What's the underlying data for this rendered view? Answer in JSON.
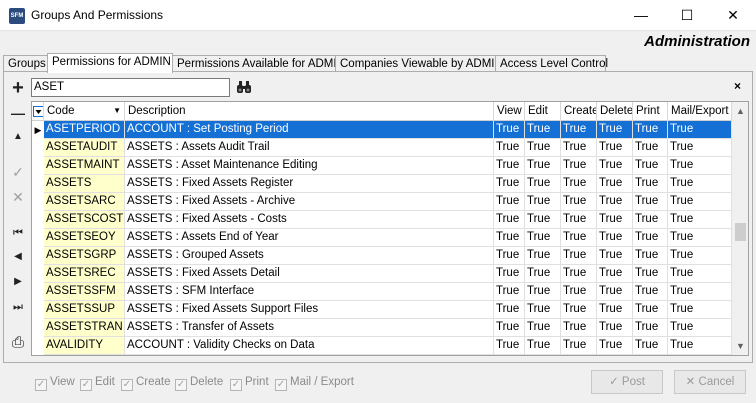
{
  "window": {
    "title": "Groups And Permissions",
    "app_icon_text": "SFM",
    "minimize_glyph": "—",
    "maximize_glyph": "☐",
    "close_glyph": "✕"
  },
  "header": {
    "section_label": "Administration"
  },
  "tabs": [
    {
      "label": "Groups",
      "active": false
    },
    {
      "label": "Permissions for ADMIN",
      "active": true
    },
    {
      "label": "Permissions Available for ADMIN",
      "active": false
    },
    {
      "label": "Companies Viewable by ADMIN",
      "active": false
    },
    {
      "label": "Access Level Control",
      "active": false
    }
  ],
  "filter": {
    "value": "ASET",
    "close_glyph": "×"
  },
  "sidebar": {
    "add_glyph": "+",
    "remove_glyph": "—",
    "up_glyph": "▲",
    "confirm_glyph": "✓",
    "cancel_glyph": "✕",
    "first_glyph": "⏮",
    "prev_glyph": "◀",
    "next_glyph": "▶",
    "last_glyph": "⏭",
    "print_glyph": "⎙"
  },
  "grid": {
    "columns": [
      "Code",
      "Description",
      "View",
      "Edit",
      "Create",
      "Delete",
      "Print",
      "Mail/Export"
    ],
    "rows": [
      [
        "ASETPERIOD",
        "ACCOUNT : Set Posting Period",
        "True",
        "True",
        "True",
        "True",
        "True",
        "True"
      ],
      [
        "ASSETAUDIT",
        "ASSETS : Assets Audit Trail",
        "True",
        "True",
        "True",
        "True",
        "True",
        "True"
      ],
      [
        "ASSETMAINT",
        "ASSETS : Asset Maintenance Editing",
        "True",
        "True",
        "True",
        "True",
        "True",
        "True"
      ],
      [
        "ASSETS",
        "ASSETS : Fixed Assets Register",
        "True",
        "True",
        "True",
        "True",
        "True",
        "True"
      ],
      [
        "ASSETSARC",
        "ASSETS : Fixed Assets - Archive",
        "True",
        "True",
        "True",
        "True",
        "True",
        "True"
      ],
      [
        "ASSETSCOST",
        "ASSETS : Fixed Assets - Costs",
        "True",
        "True",
        "True",
        "True",
        "True",
        "True"
      ],
      [
        "ASSETSEOY",
        "ASSETS : Assets End of Year",
        "True",
        "True",
        "True",
        "True",
        "True",
        "True"
      ],
      [
        "ASSETSGRP",
        "ASSETS : Grouped Assets",
        "True",
        "True",
        "True",
        "True",
        "True",
        "True"
      ],
      [
        "ASSETSREC",
        "ASSETS : Fixed Assets Detail",
        "True",
        "True",
        "True",
        "True",
        "True",
        "True"
      ],
      [
        "ASSETSSFM",
        "ASSETS : SFM Interface",
        "True",
        "True",
        "True",
        "True",
        "True",
        "True"
      ],
      [
        "ASSETSSUP",
        "ASSETS : Fixed Assets Support Files",
        "True",
        "True",
        "True",
        "True",
        "True",
        "True"
      ],
      [
        "ASSETSTRAN",
        "ASSETS : Transfer of Assets",
        "True",
        "True",
        "True",
        "True",
        "True",
        "True"
      ],
      [
        "AVALIDITY",
        "ACCOUNT : Validity Checks on Data",
        "True",
        "True",
        "True",
        "True",
        "True",
        "True"
      ]
    ],
    "selected_row": 0
  },
  "footer": {
    "checks": [
      {
        "label": "View",
        "checked": true
      },
      {
        "label": "Edit",
        "checked": true
      },
      {
        "label": "Create",
        "checked": true
      },
      {
        "label": "Delete",
        "checked": true
      },
      {
        "label": "Print",
        "checked": true
      },
      {
        "label": "Mail / Export",
        "checked": true
      }
    ],
    "post_label": "Post",
    "cancel_label": "Cancel"
  },
  "colors": {
    "selection": "#1570d5",
    "code_column": "#ffffcc"
  }
}
